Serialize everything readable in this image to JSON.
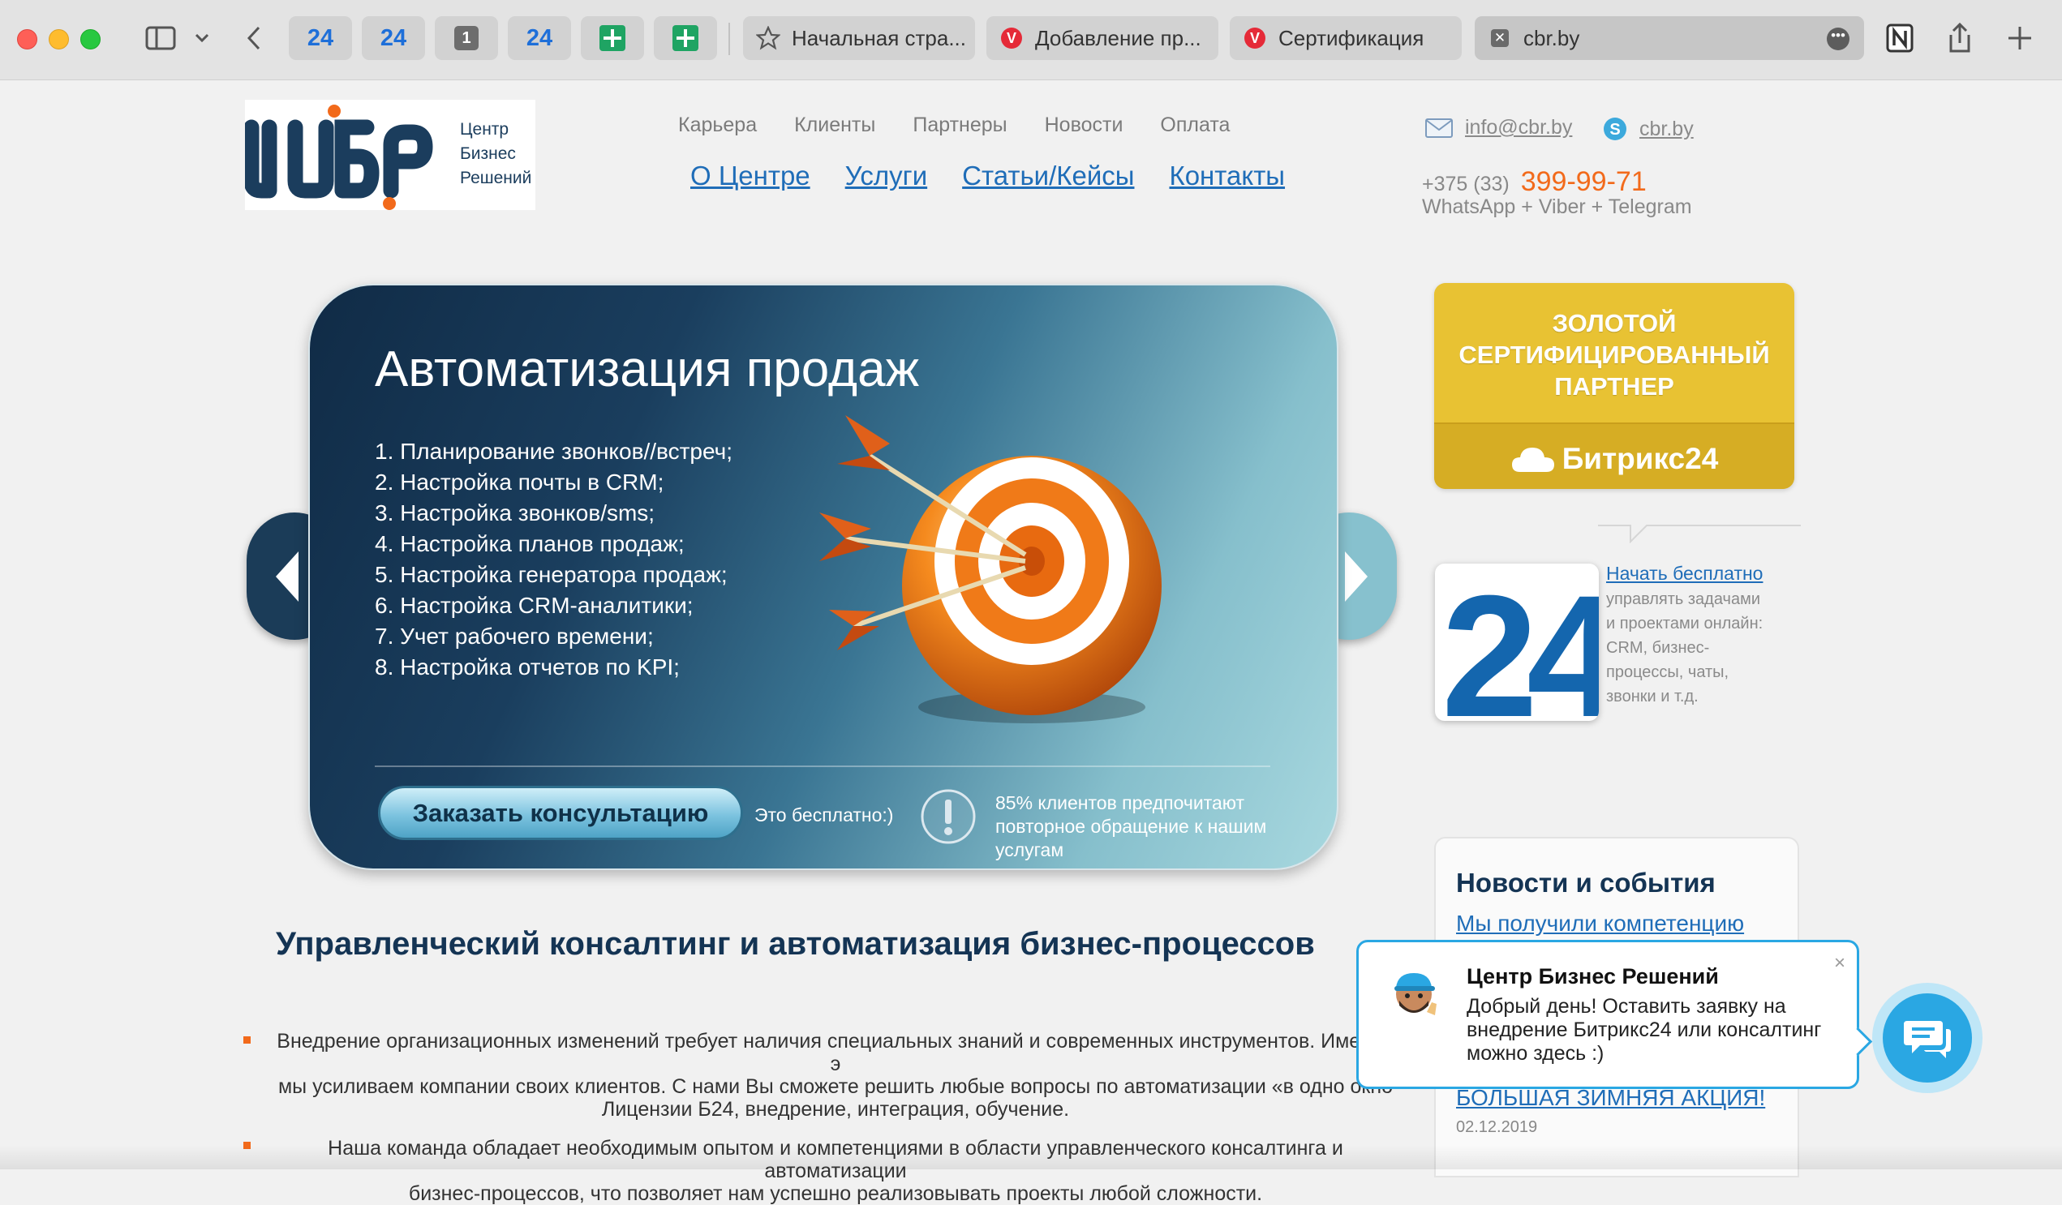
{
  "browser": {
    "pinned_tabs": [
      "24",
      "24",
      "1",
      "24"
    ],
    "tabs": [
      {
        "title": "Начальная стра..."
      },
      {
        "title": "Добавление пр..."
      },
      {
        "title": "Сертификация"
      },
      {
        "title": "cbr.by"
      }
    ],
    "icons": [
      "sidebar-icon",
      "chevron-down-icon",
      "back-icon",
      "notion-icon",
      "share-icon",
      "new-tab-icon"
    ]
  },
  "header": {
    "logo": {
      "mark": "ЦБР",
      "line1": "Центр",
      "line2": "Бизнес",
      "line3": "Решений"
    },
    "top_nav": [
      "Карьера",
      "Клиенты",
      "Партнеры",
      "Новости",
      "Оплата"
    ],
    "main_nav": [
      "О Центре",
      "Услуги",
      "Статьи/Кейсы",
      "Контакты"
    ],
    "email": "info@cbr.by",
    "skype": "cbr.by",
    "phone_code": "+375 (33)",
    "phone_number": "399-99-71",
    "messengers": "WhatsApp + Viber + Telegram"
  },
  "slider": {
    "title": "Автоматизация продаж",
    "items": [
      "1. Планирование звонков//встреч;",
      "2. Настройка почты в CRM;",
      "3. Настройка звонков/sms;",
      "4. Настройка планов продаж;",
      "5. Настройка генератора продаж;",
      "6. Настройка CRM-аналитики;",
      "7. Учет рабочего времени;",
      "8. Настройка отчетов по KPI;"
    ],
    "cta": "Заказать консультацию",
    "cta_note": "Это бесплатно:)",
    "stat": "85% клиентов предпочитают повторное обращение к нашим услугам"
  },
  "sidebar": {
    "partner_line1": "ЗОЛОТОЙ",
    "partner_line2": "СЕРТИФИЦИРОВАННЫЙ",
    "partner_line3": "ПАРТНЕР",
    "partner_brand": "Битрикс24",
    "b24_mark": "24",
    "start_link": "Начать бесплатно",
    "start_desc": "управлять задачами и проектами онлайн: CRM, бизнес-процессы, чаты, звонки и т.д.",
    "news_title": "Новости и события",
    "news_link1": "Мы получили компетенцию",
    "news_link2": "БОЛЬШАЯ ЗИМНЯЯ АКЦИЯ!",
    "news_date": "02.12.2019"
  },
  "main": {
    "heading": "Управленческий консалтинг и автоматизация бизнес-процессов",
    "p1_l1": "Внедрение организационных изменений требует наличия специальных знаний и современных инструментов. Именно э",
    "p1_l2": "мы  усиливаем компании своих клиентов. С нами Вы сможете решить любые вопросы по автоматизации «в одно окно",
    "p1_l3": "Лицензии Б24, внедрение, интеграция, обучение.",
    "p2_l1": "Наша команда обладает необходимым опытом и компетенциями в области управленческого консалтинга и автоматизации",
    "p2_l2": "бизнес-процессов, что позволяет нам успешно реализовывать проекты любой сложности."
  },
  "chat": {
    "name": "Центр Бизнес Решений",
    "message": "Добрый день! Оставить заявку на внедрение Битрикс24 или консалтинг можно здесь :)",
    "close": "×"
  },
  "colors": {
    "accent_blue": "#1f6db8",
    "orange": "#f26a1b",
    "navy": "#143454",
    "chat_blue": "#2aa7e3",
    "gold": "#e8c233"
  }
}
